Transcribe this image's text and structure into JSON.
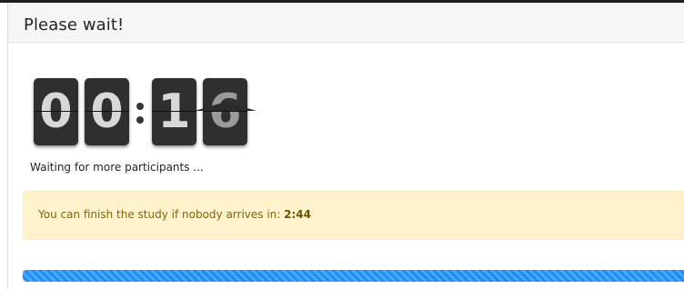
{
  "header": {
    "title": "Please wait!"
  },
  "timer": {
    "digits": [
      "0",
      "0",
      "1",
      "6"
    ],
    "separator": ":"
  },
  "status": {
    "text": "Waiting for more participants ..."
  },
  "alert": {
    "prefix": "You can finish the study if nobody arrives in: ",
    "countdown": "2:44"
  },
  "progress": {
    "value_percent": 100,
    "style": "striped",
    "color": "#1d8cf8"
  },
  "colors": {
    "alert_background": "#fff3cd",
    "alert_text": "#856404",
    "card": "#2f2f2f"
  }
}
